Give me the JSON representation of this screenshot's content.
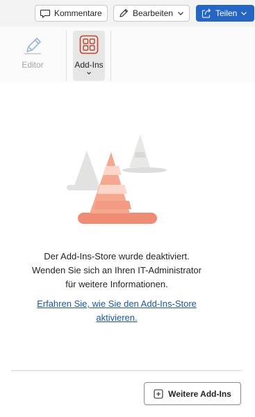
{
  "toolbar": {
    "comments_label": "Kommentare",
    "edit_label": "Bearbeiten",
    "share_label": "Teilen",
    "share_color": "#2566c4"
  },
  "ribbon": {
    "editor_label": "Editor",
    "addins_label": "Add-Ins",
    "addins_accent": "#c0452d"
  },
  "empty_state": {
    "line1": "Der Add-Ins-Store wurde deaktiviert.",
    "line2": "Wenden Sie sich an Ihren IT-Administrator",
    "line3": "für weitere Informationen.",
    "link_line1": "Erfahren Sie, wie Sie den Add-Ins-Store",
    "link_line2": "aktivieren.",
    "link_color": "#1a56a8"
  },
  "footer": {
    "more_addins_label": "Weitere Add-Ins"
  },
  "icons": {
    "comments": "comment-icon",
    "edit": "pencil-icon",
    "share": "share-icon",
    "editor": "editor-pen-icon",
    "addins": "grid-icon",
    "illustration": "traffic-cones",
    "more": "plus-box-icon"
  }
}
